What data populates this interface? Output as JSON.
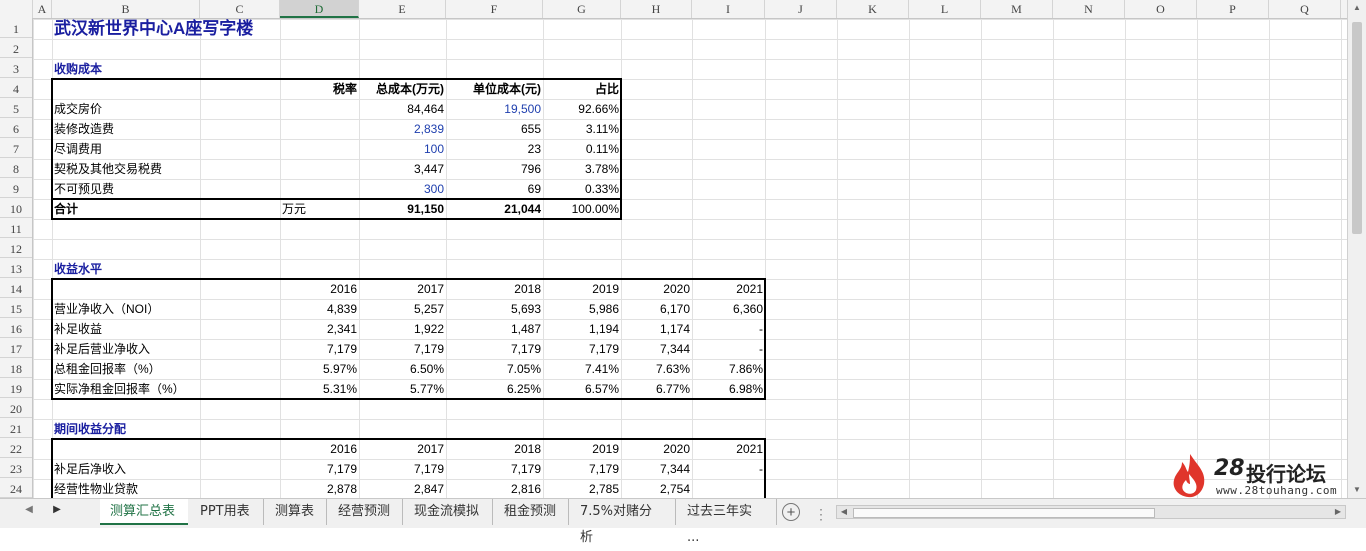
{
  "columns": [
    "A",
    "B",
    "C",
    "D",
    "E",
    "F",
    "G",
    "H",
    "I",
    "J",
    "K",
    "L",
    "M",
    "N",
    "O",
    "P",
    "Q"
  ],
  "rows": [
    "1",
    "2",
    "3",
    "4",
    "5",
    "6",
    "7",
    "8",
    "9",
    "10",
    "11",
    "12",
    "13",
    "14",
    "15",
    "16",
    "17",
    "18",
    "19",
    "20",
    "21",
    "22",
    "23",
    "24"
  ],
  "title": "武汉新世界中心A座写字楼",
  "acq": {
    "section": "收购成本",
    "headers": {
      "tax": "税率",
      "total": "总成本(万元)",
      "unit": "单位成本(元)",
      "pct": "占比"
    },
    "rows": [
      {
        "label": "成交房价",
        "tax": "",
        "total": "84,464",
        "unit": "19,500",
        "pct": "92.66%",
        "total_blue": false,
        "unit_blue": true
      },
      {
        "label": "装修改造费",
        "tax": "",
        "total": "2,839",
        "unit": "655",
        "pct": "3.11%",
        "total_blue": true,
        "unit_blue": false
      },
      {
        "label": "尽调费用",
        "tax": "",
        "total": "100",
        "unit": "23",
        "pct": "0.11%",
        "total_blue": true,
        "unit_blue": false
      },
      {
        "label": "契税及其他交易税费",
        "tax": "",
        "total": "3,447",
        "unit": "796",
        "pct": "3.78%",
        "total_blue": false,
        "unit_blue": false
      },
      {
        "label": "不可预见费",
        "tax": "",
        "total": "300",
        "unit": "69",
        "pct": "0.33%",
        "total_blue": true,
        "unit_blue": false
      }
    ],
    "total": {
      "label": "合计",
      "tax": "万元",
      "total": "91,150",
      "unit": "21,044",
      "pct": "100.00%"
    }
  },
  "income": {
    "section": "收益水平",
    "years": [
      "2016",
      "2017",
      "2018",
      "2019",
      "2020",
      "2021"
    ],
    "rows": [
      {
        "label": "营业净收入（NOI）",
        "values": [
          "4,839",
          "5,257",
          "5,693",
          "5,986",
          "6,170",
          "6,360"
        ]
      },
      {
        "label": "补足收益",
        "values": [
          "2,341",
          "1,922",
          "1,487",
          "1,194",
          "1,174",
          "-"
        ]
      },
      {
        "label": "补足后营业净收入",
        "values": [
          "7,179",
          "7,179",
          "7,179",
          "7,179",
          "7,344",
          "-"
        ]
      },
      {
        "label": "总租金回报率（%）",
        "values": [
          "5.97%",
          "6.50%",
          "7.05%",
          "7.41%",
          "7.63%",
          "7.86%"
        ]
      },
      {
        "label": "实际净租金回报率（%）",
        "values": [
          "5.31%",
          "5.77%",
          "6.25%",
          "6.57%",
          "6.77%",
          "6.98%"
        ]
      }
    ]
  },
  "dist": {
    "section": "期间收益分配",
    "years": [
      "2016",
      "2017",
      "2018",
      "2019",
      "2020",
      "2021"
    ],
    "rows": [
      {
        "label": "补足后净收入",
        "values": [
          "7,179",
          "7,179",
          "7,179",
          "7,179",
          "7,344",
          "-"
        ]
      },
      {
        "label": "经营性物业贷款",
        "values": [
          "2,878",
          "2,847",
          "2,816",
          "2,785",
          "2,754",
          ""
        ]
      }
    ]
  },
  "tabs": [
    "测算汇总表",
    "PPT用表",
    "测算表",
    "经营预测",
    "现金流模拟",
    "租金预测",
    "7.5%对赌分析",
    "过去三年实 ..."
  ],
  "active_tab": 0,
  "watermark": {
    "num": "28",
    "text": "投行论坛",
    "url": "www.28touhang.com"
  },
  "accent": "#217346"
}
